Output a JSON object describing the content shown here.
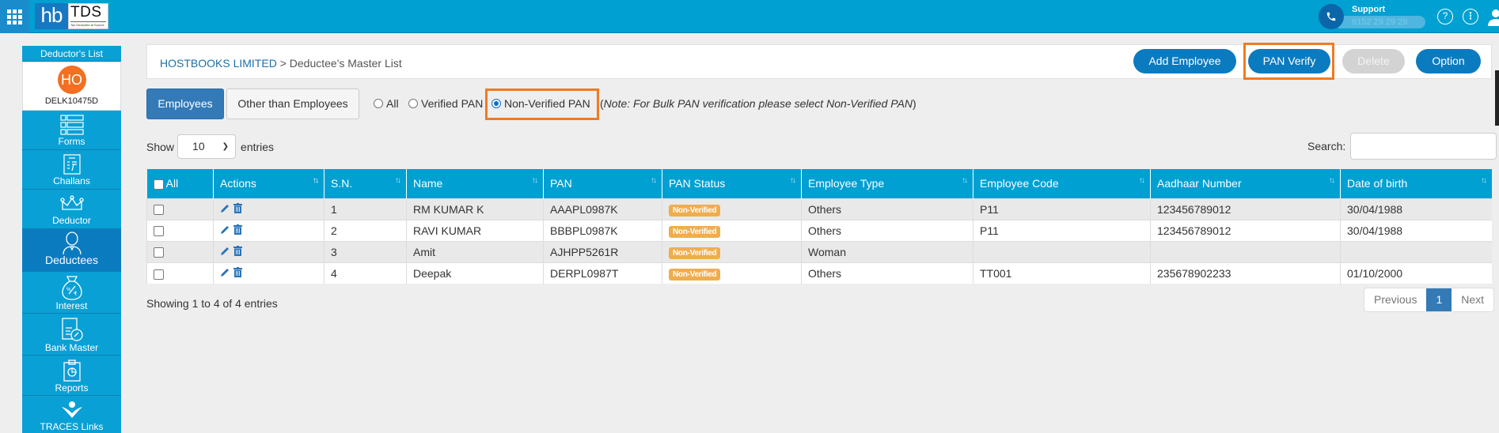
{
  "topbar": {
    "logo_hb": "hb",
    "logo_tds": "TDS",
    "logo_tagline": "Tax Deducted at Source",
    "support_label": "Support",
    "support_number": "9152 29 29 29",
    "help_icon": "?",
    "more_icon": "⋮"
  },
  "sidebar": {
    "header": "Deductor's List",
    "deductor_initials": "HO",
    "deductor_code": "DELK10475D",
    "items": [
      {
        "label": "Forms",
        "icon": "list-icon"
      },
      {
        "label": "Challans",
        "icon": "receipt-rupee-icon"
      },
      {
        "label": "Deductor",
        "icon": "crown-icon"
      },
      {
        "label": "Deductees",
        "icon": "person-icon",
        "active": true
      },
      {
        "label": "Interest",
        "icon": "money-bag-icon"
      },
      {
        "label": "Bank Master",
        "icon": "bank-document-icon"
      },
      {
        "label": "Reports",
        "icon": "clipboard-chart-icon"
      },
      {
        "label": "TRACES Links",
        "icon": "traces-icon"
      }
    ]
  },
  "header": {
    "company": "HOSTBOOKS LIMITED",
    "separator": " > ",
    "page": "Deductee's Master List",
    "buttons": {
      "add_employee": "Add Employee",
      "pan_verify": "PAN Verify",
      "delete": "Delete",
      "option": "Option"
    }
  },
  "tabs": {
    "employees": "Employees",
    "other": "Other than Employees"
  },
  "filters": {
    "all": "All",
    "verified": "Verified PAN",
    "non_verified": "Non-Verified PAN",
    "selected": "non_verified",
    "note_open": "(",
    "note": "Note: For Bulk PAN verification please select Non-Verified PAN",
    "note_close": ")"
  },
  "length": {
    "show": "Show",
    "value": "10",
    "entries": "entries"
  },
  "search": {
    "label": "Search:",
    "value": ""
  },
  "table": {
    "columns": [
      "All",
      "Actions",
      "S.N.",
      "Name",
      "PAN",
      "PAN Status",
      "Employee Type",
      "Employee Code",
      "Aadhaar Number",
      "Date of birth"
    ],
    "rows": [
      {
        "sn": "1",
        "name": "RM KUMAR K",
        "pan": "AAAPL0987K",
        "status": "Non-Verified",
        "type": "Others",
        "code": "P11",
        "aadhaar": "123456789012",
        "dob": "30/04/1988"
      },
      {
        "sn": "2",
        "name": "RAVI KUMAR",
        "pan": "BBBPL0987K",
        "status": "Non-Verified",
        "type": "Others",
        "code": "P11",
        "aadhaar": "123456789012",
        "dob": "30/04/1988"
      },
      {
        "sn": "3",
        "name": "Amit",
        "pan": "AJHPP5261R",
        "status": "Non-Verified",
        "type": "Woman",
        "code": "",
        "aadhaar": "",
        "dob": ""
      },
      {
        "sn": "4",
        "name": "Deepak",
        "pan": "DERPL0987T",
        "status": "Non-Verified",
        "type": "Others",
        "code": "TT001",
        "aadhaar": "235678902233",
        "dob": "01/10/2000"
      }
    ]
  },
  "footer": {
    "info": "Showing 1 to 4 of 4 entries",
    "previous": "Previous",
    "current_page": "1",
    "next": "Next"
  },
  "colors": {
    "brand": "#00a0d2",
    "primary": "#0b7bc0",
    "highlight": "#f37a20",
    "badge": "#f0ad4e",
    "avatar": "#f36f21"
  }
}
